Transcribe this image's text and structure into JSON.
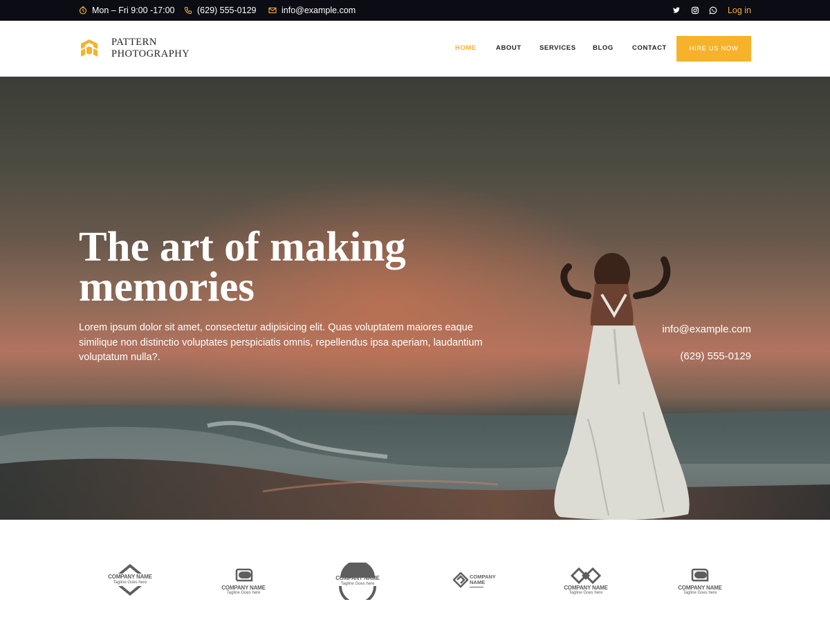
{
  "topbar": {
    "hours": "Mon – Fri 9:00 -17:00",
    "phone": "(629) 555-0129",
    "email": "info@example.com",
    "social_icons": [
      "twitter-icon",
      "instagram-icon",
      "whatsapp-icon"
    ],
    "login": "Log in"
  },
  "header": {
    "logo_line1": "PATTERN",
    "logo_line2": "PHOTOGRAPHY",
    "nav": [
      "HOME",
      "ABOUT",
      "SERVICES",
      "BLOG",
      "CONTACT"
    ],
    "active_nav": "HOME",
    "cta": "HIRE US NOW"
  },
  "hero": {
    "title_line1": "The art of making",
    "title_line2": "memories",
    "text": "Lorem ipsum dolor sit amet, consectetur adipisicing elit. Quas voluptatem maiores eaque similique non distinctio voluptates perspiciatis omnis, repellendus ipsa aperiam, laudantium voluptatum nulla?.",
    "email": "info@example.com",
    "phone": "(629) 555-0129"
  },
  "logos": [
    {
      "name": "COMPANY NAME",
      "tagline": "Tagline Goes here"
    },
    {
      "name": "COMPANY NAME",
      "tagline": "Tagline Goes here"
    },
    {
      "name": "COMPANY NAME",
      "tagline": "Tagline Goes here"
    },
    {
      "name": "COMPANY NAME",
      "tagline": ""
    },
    {
      "name": "COMPANY NAME",
      "tagline": "Tagline Goes here"
    },
    {
      "name": "COMPANY NAME",
      "tagline": "Tagline Goes here"
    }
  ],
  "logo4_line1": "COMPANY",
  "logo4_line2": "NAME",
  "colors": {
    "accent": "#f6b22a",
    "topbar_bg": "#0c0c14",
    "text_dark": "#222222",
    "logo_gray": "#5e5e5e"
  }
}
